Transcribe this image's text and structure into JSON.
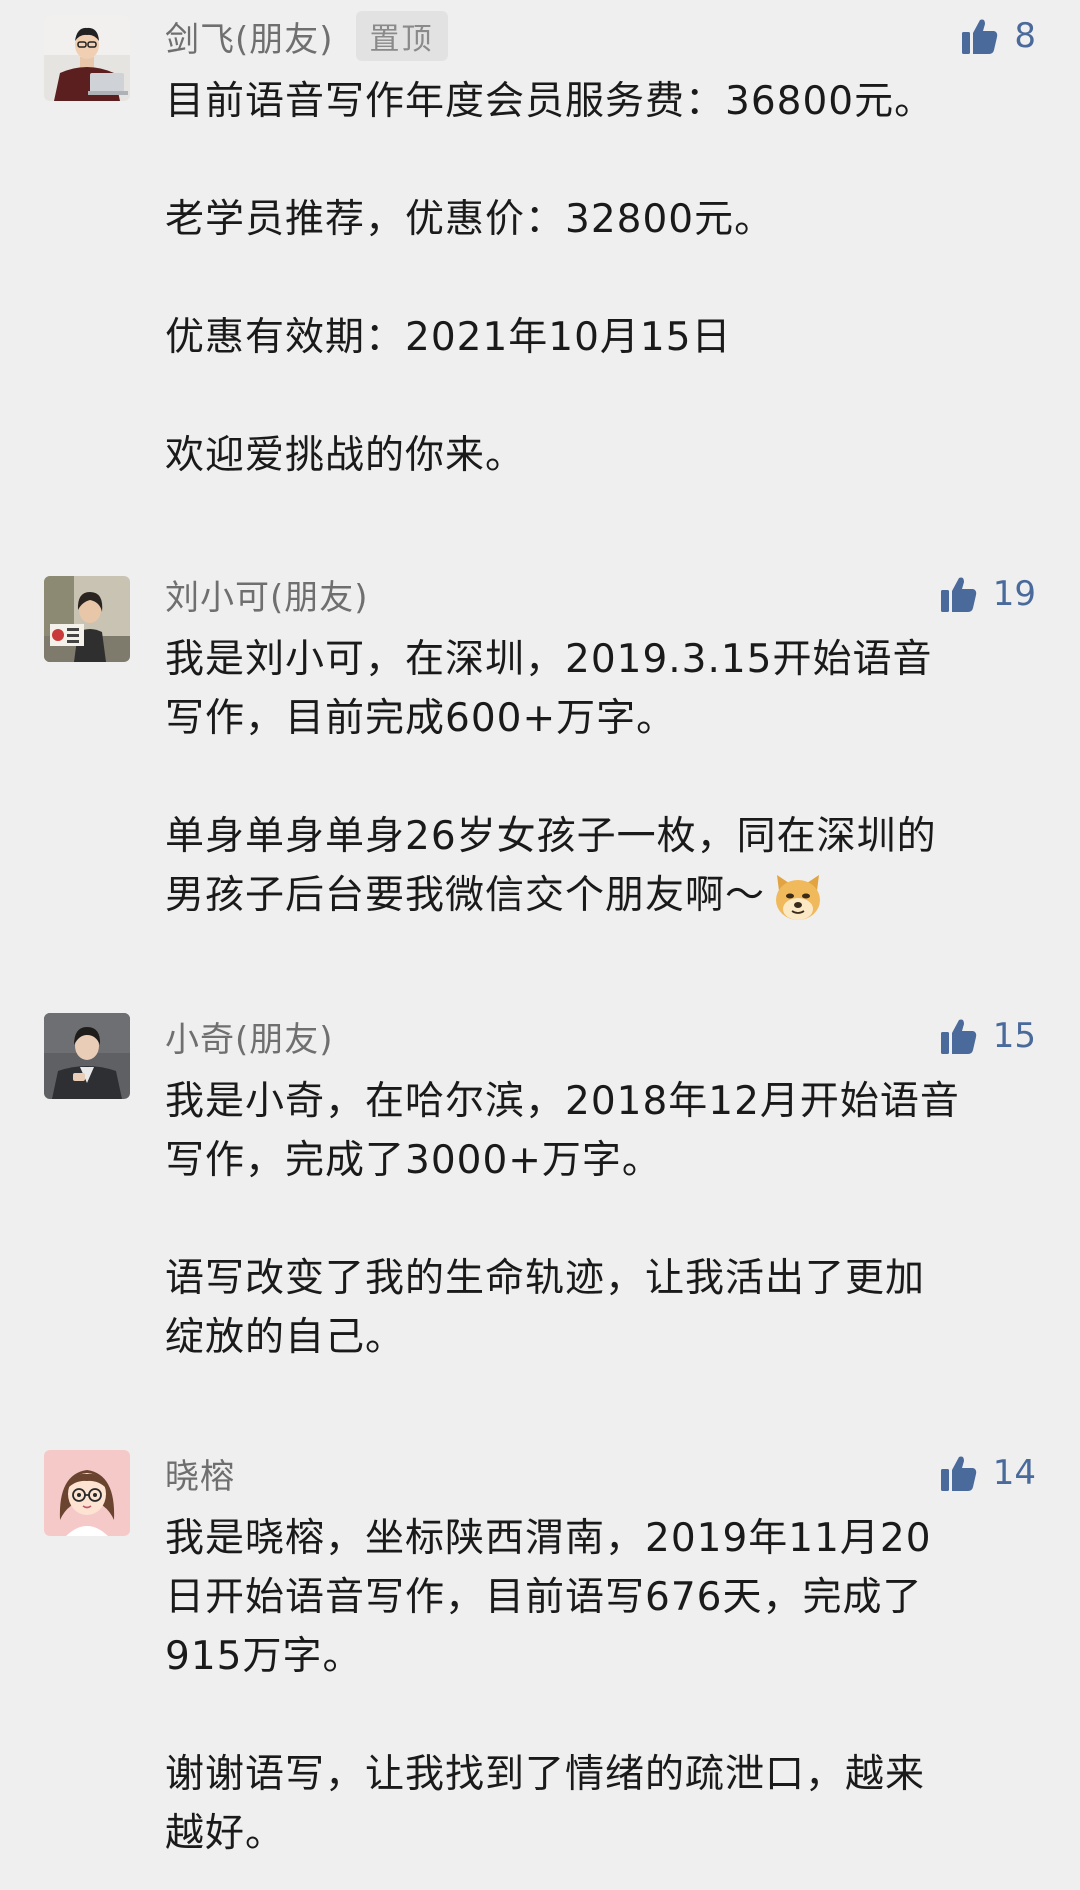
{
  "colors": {
    "background": "#efefef",
    "name_text": "#6f6f6f",
    "like_accent": "#4a6a9b",
    "body_text": "#1a1a1a",
    "pin_badge_bg": "#e2e2e2"
  },
  "comments": [
    {
      "name": "剑飞(朋友)",
      "badge": "置顶",
      "likes": "8",
      "avatar_icon": "man-with-laptop-avatar",
      "lines": [
        "目前语音写作年度会员服务费：36800元。",
        "",
        "老学员推荐，优惠价：32800元。",
        "",
        "优惠有效期：2021年10月15日",
        "",
        "欢迎爱挑战的你来。"
      ]
    },
    {
      "name": "刘小可(朋友)",
      "likes": "19",
      "avatar_icon": "woman-holding-sign-avatar",
      "lines": [
        "我是刘小可，在深圳，2019.3.15开始语音",
        "写作，目前完成600+万字。",
        "",
        "单身单身单身26岁女孩子一枚，同在深圳的",
        "男孩子后台要我微信交个朋友啊～"
      ],
      "emoji": "doge-emoji-icon"
    },
    {
      "name": "小奇(朋友)",
      "likes": "15",
      "avatar_icon": "woman-in-suit-avatar",
      "lines": [
        "我是小奇，在哈尔滨，2018年12月开始语音",
        "写作，完成了3000+万字。",
        "",
        "语写改变了我的生命轨迹，让我活出了更加",
        "绽放的自己。"
      ]
    },
    {
      "name": "晓榕",
      "likes": "14",
      "avatar_icon": "cartoon-girl-glasses-avatar",
      "lines": [
        "我是晓榕，坐标陕西渭南，2019年11月20",
        "日开始语音写作，目前语写676天，完成了",
        "915万字。",
        "",
        "谢谢语写，让我找到了情绪的疏泄口，越来",
        "越好。"
      ]
    }
  ]
}
